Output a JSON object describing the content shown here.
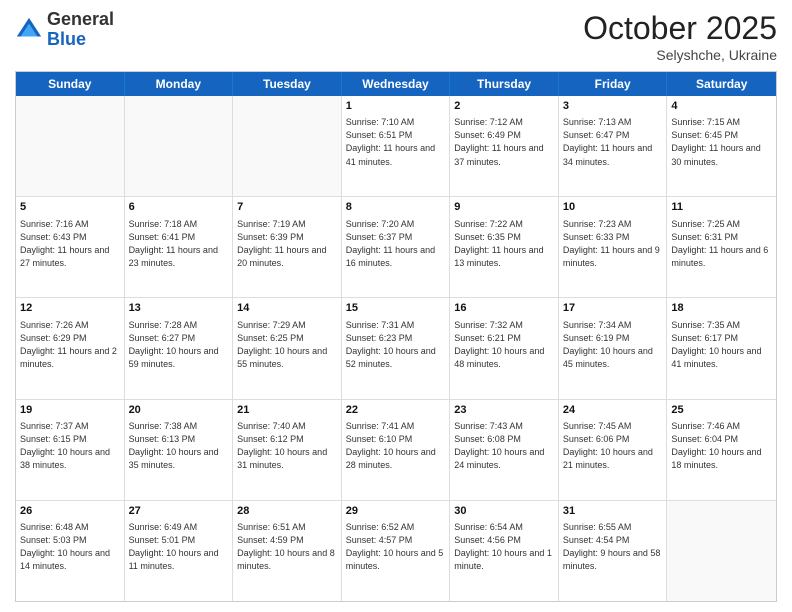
{
  "header": {
    "logo": {
      "line1": "General",
      "line2": "Blue"
    },
    "title": "October 2025",
    "location": "Selyshche, Ukraine"
  },
  "weekdays": [
    "Sunday",
    "Monday",
    "Tuesday",
    "Wednesday",
    "Thursday",
    "Friday",
    "Saturday"
  ],
  "rows": [
    [
      {
        "day": "",
        "text": ""
      },
      {
        "day": "",
        "text": ""
      },
      {
        "day": "",
        "text": ""
      },
      {
        "day": "1",
        "text": "Sunrise: 7:10 AM\nSunset: 6:51 PM\nDaylight: 11 hours\nand 41 minutes."
      },
      {
        "day": "2",
        "text": "Sunrise: 7:12 AM\nSunset: 6:49 PM\nDaylight: 11 hours\nand 37 minutes."
      },
      {
        "day": "3",
        "text": "Sunrise: 7:13 AM\nSunset: 6:47 PM\nDaylight: 11 hours\nand 34 minutes."
      },
      {
        "day": "4",
        "text": "Sunrise: 7:15 AM\nSunset: 6:45 PM\nDaylight: 11 hours\nand 30 minutes."
      }
    ],
    [
      {
        "day": "5",
        "text": "Sunrise: 7:16 AM\nSunset: 6:43 PM\nDaylight: 11 hours\nand 27 minutes."
      },
      {
        "day": "6",
        "text": "Sunrise: 7:18 AM\nSunset: 6:41 PM\nDaylight: 11 hours\nand 23 minutes."
      },
      {
        "day": "7",
        "text": "Sunrise: 7:19 AM\nSunset: 6:39 PM\nDaylight: 11 hours\nand 20 minutes."
      },
      {
        "day": "8",
        "text": "Sunrise: 7:20 AM\nSunset: 6:37 PM\nDaylight: 11 hours\nand 16 minutes."
      },
      {
        "day": "9",
        "text": "Sunrise: 7:22 AM\nSunset: 6:35 PM\nDaylight: 11 hours\nand 13 minutes."
      },
      {
        "day": "10",
        "text": "Sunrise: 7:23 AM\nSunset: 6:33 PM\nDaylight: 11 hours\nand 9 minutes."
      },
      {
        "day": "11",
        "text": "Sunrise: 7:25 AM\nSunset: 6:31 PM\nDaylight: 11 hours\nand 6 minutes."
      }
    ],
    [
      {
        "day": "12",
        "text": "Sunrise: 7:26 AM\nSunset: 6:29 PM\nDaylight: 11 hours\nand 2 minutes."
      },
      {
        "day": "13",
        "text": "Sunrise: 7:28 AM\nSunset: 6:27 PM\nDaylight: 10 hours\nand 59 minutes."
      },
      {
        "day": "14",
        "text": "Sunrise: 7:29 AM\nSunset: 6:25 PM\nDaylight: 10 hours\nand 55 minutes."
      },
      {
        "day": "15",
        "text": "Sunrise: 7:31 AM\nSunset: 6:23 PM\nDaylight: 10 hours\nand 52 minutes."
      },
      {
        "day": "16",
        "text": "Sunrise: 7:32 AM\nSunset: 6:21 PM\nDaylight: 10 hours\nand 48 minutes."
      },
      {
        "day": "17",
        "text": "Sunrise: 7:34 AM\nSunset: 6:19 PM\nDaylight: 10 hours\nand 45 minutes."
      },
      {
        "day": "18",
        "text": "Sunrise: 7:35 AM\nSunset: 6:17 PM\nDaylight: 10 hours\nand 41 minutes."
      }
    ],
    [
      {
        "day": "19",
        "text": "Sunrise: 7:37 AM\nSunset: 6:15 PM\nDaylight: 10 hours\nand 38 minutes."
      },
      {
        "day": "20",
        "text": "Sunrise: 7:38 AM\nSunset: 6:13 PM\nDaylight: 10 hours\nand 35 minutes."
      },
      {
        "day": "21",
        "text": "Sunrise: 7:40 AM\nSunset: 6:12 PM\nDaylight: 10 hours\nand 31 minutes."
      },
      {
        "day": "22",
        "text": "Sunrise: 7:41 AM\nSunset: 6:10 PM\nDaylight: 10 hours\nand 28 minutes."
      },
      {
        "day": "23",
        "text": "Sunrise: 7:43 AM\nSunset: 6:08 PM\nDaylight: 10 hours\nand 24 minutes."
      },
      {
        "day": "24",
        "text": "Sunrise: 7:45 AM\nSunset: 6:06 PM\nDaylight: 10 hours\nand 21 minutes."
      },
      {
        "day": "25",
        "text": "Sunrise: 7:46 AM\nSunset: 6:04 PM\nDaylight: 10 hours\nand 18 minutes."
      }
    ],
    [
      {
        "day": "26",
        "text": "Sunrise: 6:48 AM\nSunset: 5:03 PM\nDaylight: 10 hours\nand 14 minutes."
      },
      {
        "day": "27",
        "text": "Sunrise: 6:49 AM\nSunset: 5:01 PM\nDaylight: 10 hours\nand 11 minutes."
      },
      {
        "day": "28",
        "text": "Sunrise: 6:51 AM\nSunset: 4:59 PM\nDaylight: 10 hours\nand 8 minutes."
      },
      {
        "day": "29",
        "text": "Sunrise: 6:52 AM\nSunset: 4:57 PM\nDaylight: 10 hours\nand 5 minutes."
      },
      {
        "day": "30",
        "text": "Sunrise: 6:54 AM\nSunset: 4:56 PM\nDaylight: 10 hours\nand 1 minute."
      },
      {
        "day": "31",
        "text": "Sunrise: 6:55 AM\nSunset: 4:54 PM\nDaylight: 9 hours\nand 58 minutes."
      },
      {
        "day": "",
        "text": ""
      }
    ]
  ]
}
